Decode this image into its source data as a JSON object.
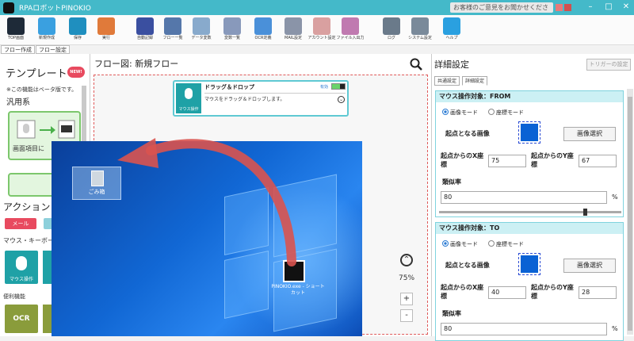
{
  "titlebar": {
    "title": "RPAロボットPINOKIO",
    "feedback": "お客様のご意見をお聞かせください"
  },
  "toolbar": [
    {
      "label": "TOP画面",
      "color": "#1e2a38"
    },
    {
      "label": "新規作成",
      "color": "#3aa0e0"
    },
    {
      "label": "保存",
      "color": "#1f8fbf"
    },
    {
      "label": "実行",
      "color": "#e07a3a"
    },
    {
      "label": "自動記録",
      "color": "#3a4fa0"
    },
    {
      "label": "フロー一覧",
      "color": "#5577aa"
    },
    {
      "label": "データ変数",
      "color": "#88aacc"
    },
    {
      "label": "変数一覧",
      "color": "#8899bb"
    },
    {
      "label": "OCR定義",
      "color": "#4a90d9"
    },
    {
      "label": "MAIL設定",
      "color": "#8a94a8"
    },
    {
      "label": "アカウント設定",
      "color": "#d9a0a0"
    },
    {
      "label": "ファイル入出力",
      "color": "#c07ab0"
    },
    {
      "label": "ログ",
      "color": "#6a7a8a"
    },
    {
      "label": "システム設定",
      "color": "#7a8a9a"
    },
    {
      "label": "ヘルプ",
      "color": "#2aa0e0"
    }
  ],
  "left_tabs": [
    "フロー作成",
    "フロー設定"
  ],
  "left": {
    "template_title": "テンプレート",
    "new_badge": "NEW!",
    "beta_note": "※この機能はベータ版です。",
    "general": "汎用系",
    "card_text": "画面項目に",
    "actions_title": "アクション",
    "mail_label": "メール",
    "mouse_kb": "マウス・キーボー",
    "mouse_tile": "マウス操作",
    "util": "便利機能",
    "ocr": "OCR"
  },
  "flow": {
    "title": "フロー図:  新規フロー",
    "node_title": "ドラッグ＆ドロップ",
    "node_valid": "有効",
    "node_desc": "マウスをドラッグ＆ドロップします。",
    "node_icon_label": "マウス操作",
    "zoom": "75%",
    "zoom_in": "+",
    "zoom_out": "-"
  },
  "desktop": {
    "recycle_label": "ごみ箱",
    "pinokio_label": "PINOKIO.exe - ショートカット"
  },
  "right": {
    "title": "詳細設定",
    "trigger_btn": "トリガーの設定",
    "tabs": [
      "共通設定",
      "詳細設定"
    ],
    "from": {
      "head": "マウス操作対象：FROM",
      "mode_image": "画像モード",
      "mode_coord": "座標モード",
      "origin_label": "起点となる画像",
      "select_btn": "画像選択",
      "x_label": "起点からのX座標",
      "x_value": "75",
      "y_label": "起点からのY座標",
      "y_value": "67",
      "sim_label": "類似率",
      "sim_value": "80",
      "pct": "%"
    },
    "to": {
      "head": "マウス操作対象：TO",
      "mode_image": "画像モード",
      "mode_coord": "座標モード",
      "origin_label": "起点となる画像",
      "select_btn": "画像選択",
      "x_label": "起点からのX座標",
      "x_value": "40",
      "y_label": "起点からのY座標",
      "y_value": "28",
      "sim_label": "類似率",
      "sim_value": "80",
      "pct": "%"
    }
  }
}
